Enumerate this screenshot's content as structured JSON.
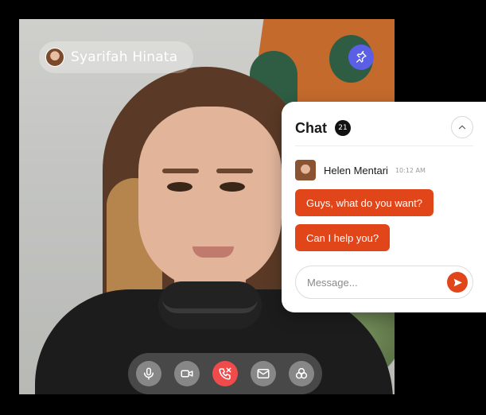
{
  "call": {
    "caller_name": "Syarifah Hinata",
    "pin_icon": "pin-icon",
    "controls": [
      {
        "name": "microphone",
        "icon": "microphone-icon"
      },
      {
        "name": "camera",
        "icon": "video-camera-icon"
      },
      {
        "name": "end-call",
        "icon": "phone-end-icon",
        "color": "#ef4b4b"
      },
      {
        "name": "message",
        "icon": "envelope-icon"
      },
      {
        "name": "effects",
        "icon": "effects-icon"
      }
    ]
  },
  "chat": {
    "title": "Chat",
    "unread_count": "21",
    "collapse_icon": "chevron-up-icon",
    "sender": {
      "name": "Helen Mentari",
      "time": "10:12 AM"
    },
    "messages": [
      {
        "text": "Guys, what do you want?"
      },
      {
        "text": "Can I help you?"
      }
    ],
    "composer": {
      "placeholder": "Message...",
      "send_icon": "send-icon"
    },
    "accent_color": "#e1451a"
  },
  "colors": {
    "pin_button": "#5b5fe6",
    "end_call": "#ef4b4b",
    "chat_accent": "#e1451a"
  }
}
